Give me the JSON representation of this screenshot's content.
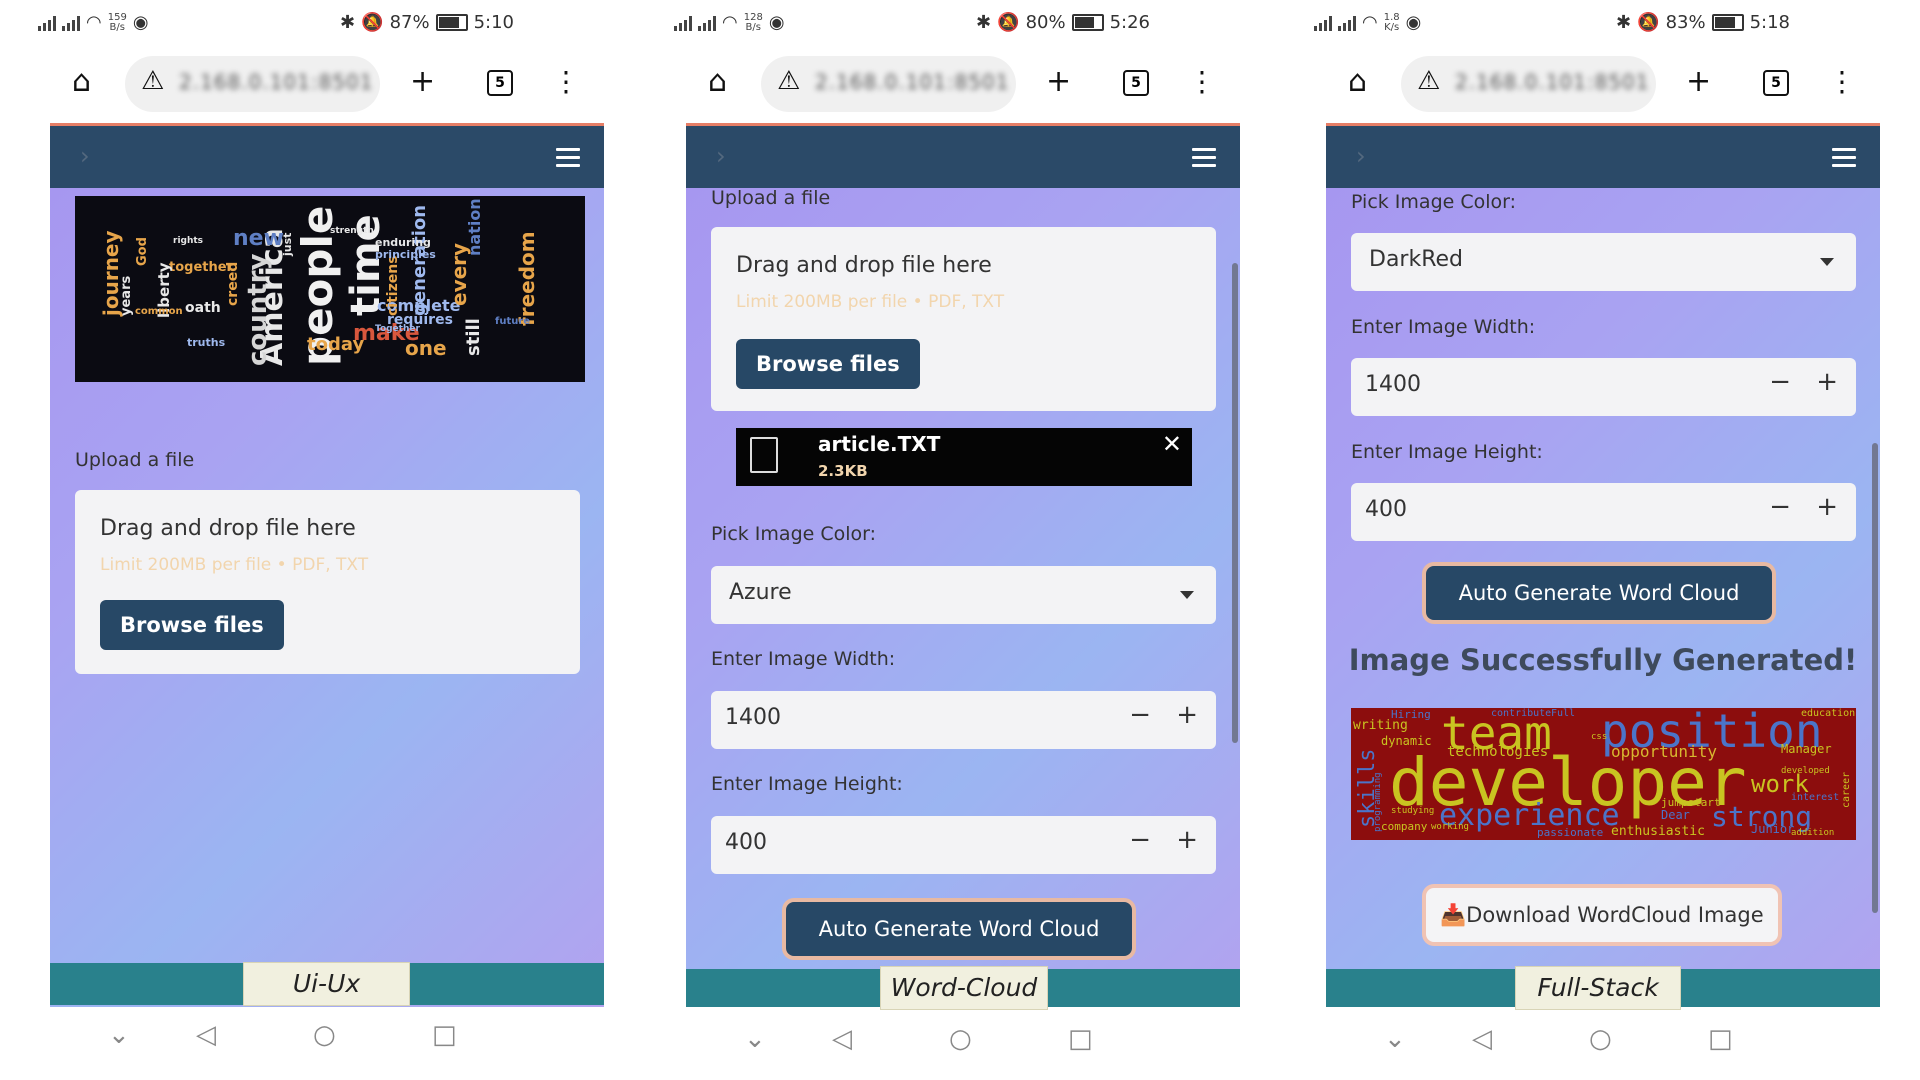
{
  "phones": [
    {
      "status": {
        "speed_num": "159",
        "speed_unit": "B/s",
        "battery": "87%",
        "time": "5:10"
      },
      "chrome": {
        "url": "2.168.0.101:8501",
        "tabs": "5"
      },
      "label": "Ui-Ux",
      "upload_label": "Upload a file",
      "drag_text": "Drag and drop file here",
      "limit_text": "Limit 200MB per file • PDF, TXT",
      "browse_label": "Browse files",
      "wordcloud_words": [
        "America",
        "people",
        "time",
        "new",
        "country",
        "today",
        "make",
        "one",
        "complete",
        "requires",
        "every",
        "nation",
        "still",
        "freedom",
        "citizens",
        "generation",
        "oath",
        "together",
        "liberty",
        "journey",
        "creed",
        "years",
        "truths",
        "principles",
        "enduring",
        "Together",
        "strength",
        "common",
        "rights",
        "God",
        "just",
        "future"
      ]
    },
    {
      "status": {
        "speed_num": "128",
        "speed_unit": "B/s",
        "battery": "80%",
        "time": "5:26"
      },
      "chrome": {
        "url": "2.168.0.101:8501",
        "tabs": "5"
      },
      "label": "Word-Cloud",
      "upload_label": "Upload a file",
      "drag_text": "Drag and drop file here",
      "limit_text": "Limit 200MB per file • PDF, TXT",
      "browse_label": "Browse files",
      "file_name": "article.TXT",
      "file_size": "2.3KB",
      "color_label": "Pick Image Color:",
      "color_value": "Azure",
      "width_label": "Enter Image Width:",
      "width_value": "1400",
      "height_label": "Enter Image Height:",
      "height_value": "400",
      "generate_label": "Auto Generate Word Cloud"
    },
    {
      "status": {
        "speed_num": "1.8",
        "speed_unit": "K/s",
        "battery": "83%",
        "time": "5:18"
      },
      "chrome": {
        "url": "2.168.0.101:8501",
        "tabs": "5"
      },
      "label": "Full-Stack",
      "color_label": "Pick Image Color:",
      "color_value": "DarkRed",
      "width_label": "Enter Image Width:",
      "width_value": "1400",
      "height_label": "Enter Image Height:",
      "height_value": "400",
      "generate_label": "Auto Generate Word Cloud",
      "success_text": "Image Successfully Generated!",
      "download_label": "📥Download WordCloud Image",
      "wordcloud_words": [
        "developer",
        "team",
        "position",
        "experience",
        "skills",
        "strong",
        "work",
        "opportunity",
        "technologies",
        "Manager",
        "dynamic",
        "writing",
        "Hiring",
        "contribute",
        "Full",
        "jumpstart",
        "Dear",
        "passionate",
        "enthusiastic",
        "company",
        "programming",
        "career",
        "interest",
        "developed",
        "education",
        "studying",
        "working",
        "Junior",
        "addition",
        "css"
      ]
    }
  ],
  "icons": [
    "home-icon",
    "warning-icon",
    "plus-icon",
    "tab-switcher-icon",
    "more-icon",
    "menu-icon",
    "chevron-right-icon",
    "document-icon",
    "close-icon",
    "back-icon",
    "home-circle-icon",
    "recents-icon",
    "collapse-icon"
  ]
}
